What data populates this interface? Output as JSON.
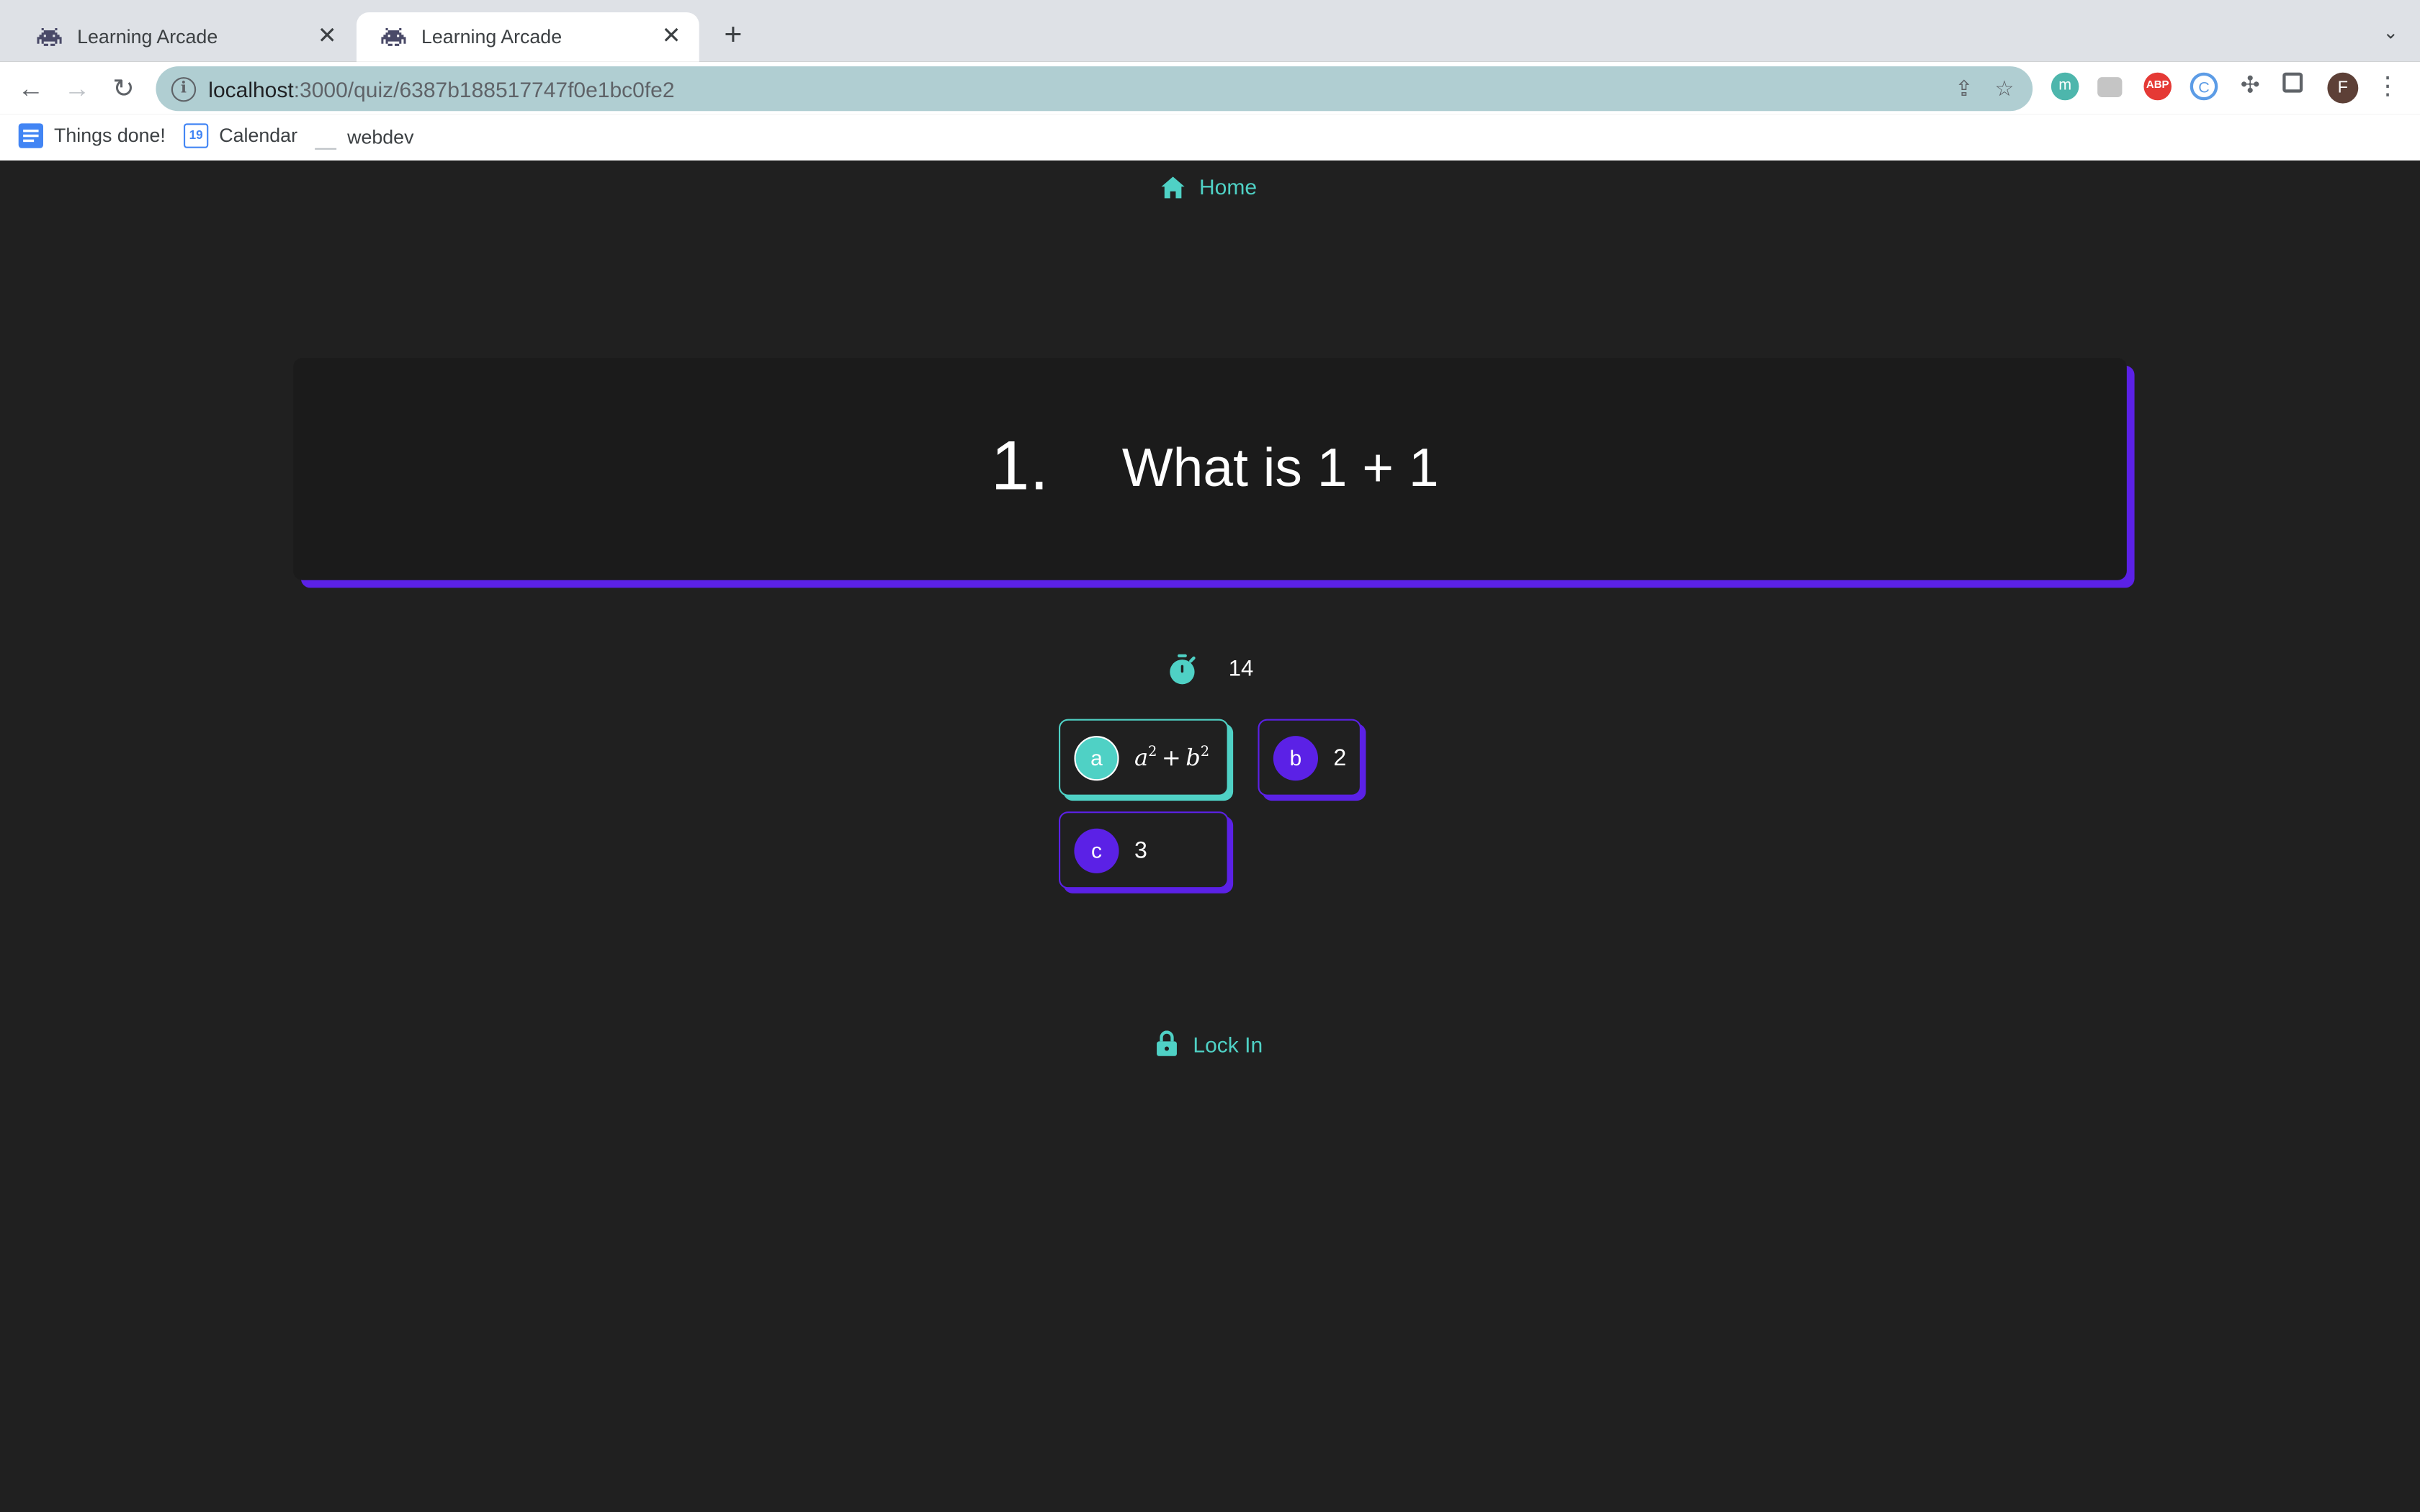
{
  "browser": {
    "tabs": [
      {
        "title": "Learning Arcade",
        "active": false
      },
      {
        "title": "Learning Arcade",
        "active": true
      }
    ],
    "url_host": "localhost",
    "url_path": ":3000/quiz/6387b188517747f0e1bc0fe2",
    "bookmarks": [
      "Things done!",
      "Calendar",
      "webdev"
    ],
    "calendar_icon_number": "19",
    "profile_initial": "F",
    "extensions": [
      "m",
      "abp"
    ]
  },
  "nav": {
    "home_label": "Home"
  },
  "question": {
    "number": "1.",
    "text": "What is 1 + 1"
  },
  "timer": {
    "seconds": "14"
  },
  "answers": [
    {
      "letter": "a",
      "text": "a^2 + b^2",
      "selected": true
    },
    {
      "letter": "b",
      "text": "2",
      "selected": false
    },
    {
      "letter": "c",
      "text": "3",
      "selected": false
    }
  ],
  "lock_in_label": "Lock In",
  "colors": {
    "accent_teal": "#4fd1c5",
    "accent_purple": "#5b21e6",
    "background": "#202020"
  }
}
